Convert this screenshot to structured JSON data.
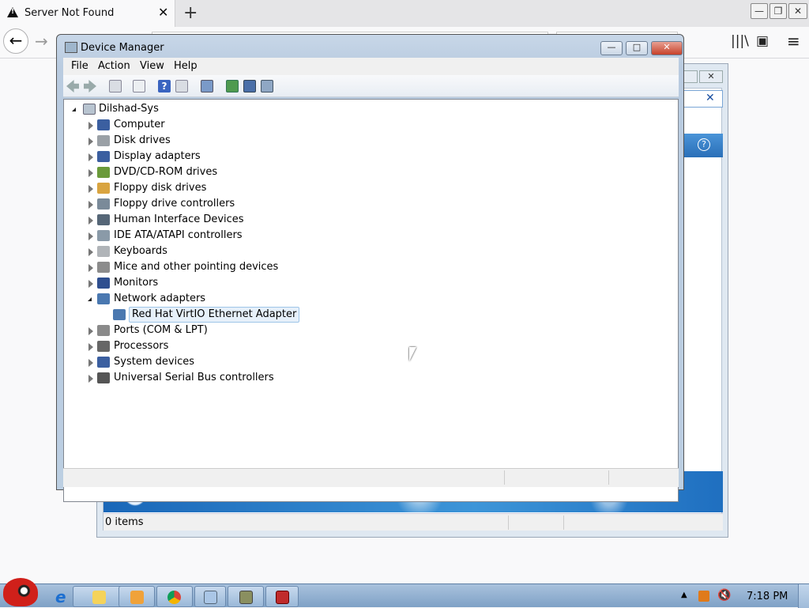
{
  "browser": {
    "tab_title": "Server Not Found",
    "tab_close": "✕",
    "new_tab": "+",
    "back": "←",
    "forward": "→",
    "window_min": "—",
    "window_restore": "❐",
    "window_close": "✕",
    "library_icon": "|||\\",
    "sidebar_icon": "▣",
    "menu_icon": "≡"
  },
  "background_window": {
    "status_text": "0 items",
    "close_label": "✕",
    "search_clear": "✕",
    "help_label": "?"
  },
  "device_manager": {
    "title": "Device Manager",
    "min_label": "—",
    "max_label": "□",
    "close_label": "✕",
    "menu": [
      "File",
      "Action",
      "View",
      "Help"
    ],
    "tree": {
      "root": "Dilshad-Sys",
      "categories": [
        {
          "label": "Computer",
          "icon": "computer-icon",
          "expanded": false
        },
        {
          "label": "Disk drives",
          "icon": "disk-drive-icon",
          "expanded": false
        },
        {
          "label": "Display adapters",
          "icon": "display-adapter-icon",
          "expanded": false
        },
        {
          "label": "DVD/CD-ROM drives",
          "icon": "dvd-drive-icon",
          "expanded": false
        },
        {
          "label": "Floppy disk drives",
          "icon": "floppy-disk-icon",
          "expanded": false
        },
        {
          "label": "Floppy drive controllers",
          "icon": "floppy-controller-icon",
          "expanded": false
        },
        {
          "label": "Human Interface Devices",
          "icon": "hid-icon",
          "expanded": false
        },
        {
          "label": "IDE ATA/ATAPI controllers",
          "icon": "ide-controller-icon",
          "expanded": false
        },
        {
          "label": "Keyboards",
          "icon": "keyboard-icon",
          "expanded": false
        },
        {
          "label": "Mice and other pointing devices",
          "icon": "mouse-icon",
          "expanded": false
        },
        {
          "label": "Monitors",
          "icon": "monitor-icon",
          "expanded": false
        },
        {
          "label": "Network adapters",
          "icon": "network-adapter-icon",
          "expanded": true
        },
        {
          "label": "Red Hat VirtIO Ethernet Adapter",
          "icon": "ethernet-adapter-icon",
          "child": true,
          "selected": true
        },
        {
          "label": "Ports (COM & LPT)",
          "icon": "port-icon",
          "expanded": false
        },
        {
          "label": "Processors",
          "icon": "processor-icon",
          "expanded": false
        },
        {
          "label": "System devices",
          "icon": "system-device-icon",
          "expanded": false
        },
        {
          "label": "Universal Serial Bus controllers",
          "icon": "usb-icon",
          "expanded": false
        }
      ]
    }
  },
  "taskbar": {
    "clock": "7:18 PM",
    "apps": [
      "ie-icon",
      "explorer-icon",
      "media-player-icon",
      "chrome-icon",
      "control-panel-icon",
      "mycomputer-icon",
      "toolbox-icon"
    ]
  },
  "colors": {
    "accent": "#3d95d8",
    "selection": "#e6f0fa",
    "taskbar": "#9ab8d8"
  }
}
